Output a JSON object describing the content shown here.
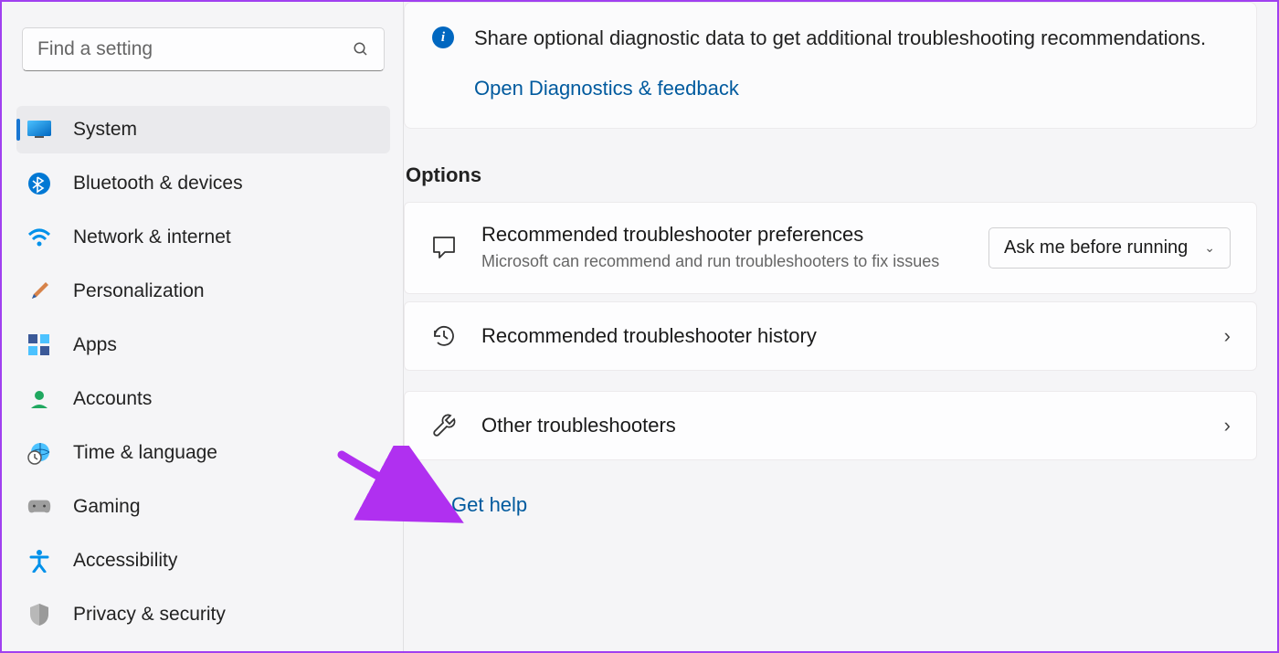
{
  "search": {
    "placeholder": "Find a setting"
  },
  "nav": {
    "items": [
      {
        "id": "system",
        "label": "System"
      },
      {
        "id": "bluetooth",
        "label": "Bluetooth & devices"
      },
      {
        "id": "network",
        "label": "Network & internet"
      },
      {
        "id": "personalization",
        "label": "Personalization"
      },
      {
        "id": "apps",
        "label": "Apps"
      },
      {
        "id": "accounts",
        "label": "Accounts"
      },
      {
        "id": "time",
        "label": "Time & language"
      },
      {
        "id": "gaming",
        "label": "Gaming"
      },
      {
        "id": "accessibility",
        "label": "Accessibility"
      },
      {
        "id": "privacy",
        "label": "Privacy & security"
      }
    ]
  },
  "info": {
    "text": "Share optional diagnostic data to get additional troubleshooting recommendations.",
    "link": "Open Diagnostics & feedback"
  },
  "options": {
    "heading": "Options",
    "pref": {
      "title": "Recommended troubleshooter preferences",
      "sub": "Microsoft can recommend and run troubleshooters to fix issues",
      "selected": "Ask me before running"
    },
    "history": {
      "title": "Recommended troubleshooter history"
    },
    "other": {
      "title": "Other troubleshooters"
    }
  },
  "help": {
    "label": "Get help"
  }
}
